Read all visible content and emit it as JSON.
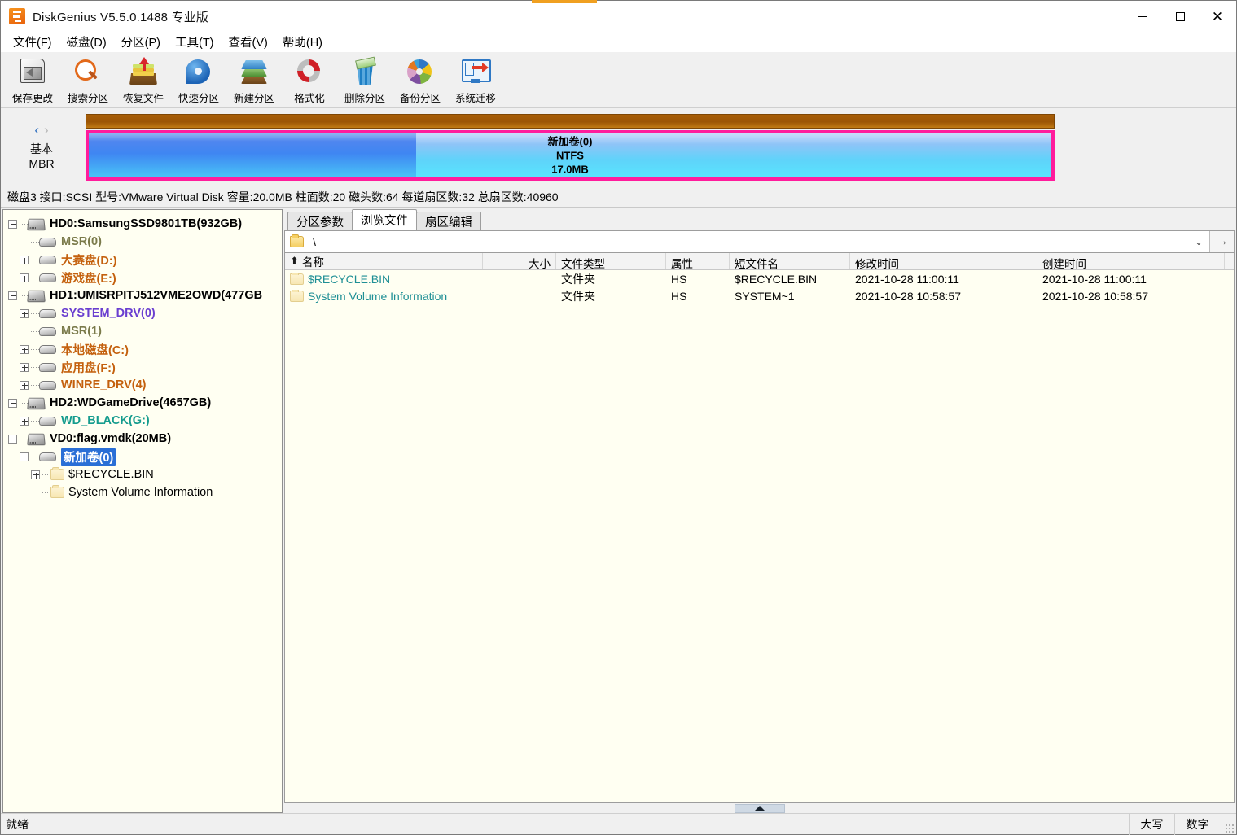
{
  "window": {
    "title": "DiskGenius V5.5.0.1488 专业版",
    "logo_icon": "diskgenius-logo-icon",
    "minimize_label": "—",
    "maximize_label": "",
    "close_label": "✕"
  },
  "menubar": {
    "items": [
      {
        "label": "文件(F)",
        "name": "menu-file"
      },
      {
        "label": "磁盘(D)",
        "name": "menu-disk"
      },
      {
        "label": "分区(P)",
        "name": "menu-partition"
      },
      {
        "label": "工具(T)",
        "name": "menu-tools"
      },
      {
        "label": "查看(V)",
        "name": "menu-view"
      },
      {
        "label": "帮助(H)",
        "name": "menu-help"
      }
    ]
  },
  "toolbar": {
    "buttons": [
      {
        "label": "保存更改",
        "icon": "save-changes-icon"
      },
      {
        "label": "搜索分区",
        "icon": "search-partition-icon"
      },
      {
        "label": "恢复文件",
        "icon": "recover-files-icon"
      },
      {
        "label": "快速分区",
        "icon": "quick-partition-icon"
      },
      {
        "label": "新建分区",
        "icon": "new-partition-icon"
      },
      {
        "label": "格式化",
        "icon": "format-icon"
      },
      {
        "label": "删除分区",
        "icon": "delete-partition-icon"
      },
      {
        "label": "备份分区",
        "icon": "backup-partition-icon"
      },
      {
        "label": "系统迁移",
        "icon": "system-migration-icon"
      }
    ]
  },
  "diskmap": {
    "prev_arrow": "‹",
    "next_arrow": "›",
    "disk_style_line1": "基本",
    "disk_style_line2": "MBR",
    "partition": {
      "name": "新加卷(0)",
      "filesystem": "NTFS",
      "size": "17.0MB",
      "used_percent": 34,
      "border_color": "#ff1c9c"
    }
  },
  "diskinfo": {
    "text": "磁盘3 接口:SCSI  型号:VMware Virtual Disk  容量:20.0MB  柱面数:20  磁头数:64  每道扇区数:32  总扇区数:40960"
  },
  "tree": {
    "nodes": [
      {
        "label": "HD0:SamsungSSD9801TB(932GB)",
        "icon": "disk-icon",
        "expander": "minus",
        "indent": 0,
        "color": "#000000",
        "bold": true
      },
      {
        "label": "MSR(0)",
        "icon": "partition-icon",
        "expander": "none",
        "indent": 1,
        "color": "#7a7a4a",
        "bold": true
      },
      {
        "label": "大赛盘(D:)",
        "icon": "partition-icon",
        "expander": "plus",
        "indent": 1,
        "color": "#c4600d",
        "bold": true
      },
      {
        "label": "游戏盘(E:)",
        "icon": "partition-icon",
        "expander": "plus",
        "indent": 1,
        "color": "#c4600d",
        "bold": true
      },
      {
        "label": "HD1:UMISRPITJ512VME2OWD(477GB",
        "icon": "disk-icon",
        "expander": "minus",
        "indent": 0,
        "color": "#000000",
        "bold": true
      },
      {
        "label": "SYSTEM_DRV(0)",
        "icon": "partition-icon",
        "expander": "plus",
        "indent": 1,
        "color": "#6a3fd0",
        "bold": true
      },
      {
        "label": "MSR(1)",
        "icon": "partition-icon",
        "expander": "none",
        "indent": 1,
        "color": "#7a7a4a",
        "bold": true
      },
      {
        "label": "本地磁盘(C:)",
        "icon": "partition-icon",
        "expander": "plus",
        "indent": 1,
        "color": "#c4600d",
        "bold": true
      },
      {
        "label": "应用盘(F:)",
        "icon": "partition-icon",
        "expander": "plus",
        "indent": 1,
        "color": "#c4600d",
        "bold": true
      },
      {
        "label": "WINRE_DRV(4)",
        "icon": "partition-icon",
        "expander": "plus",
        "indent": 1,
        "color": "#c4600d",
        "bold": true
      },
      {
        "label": "HD2:WDGameDrive(4657GB)",
        "icon": "disk-icon",
        "expander": "minus",
        "indent": 0,
        "color": "#000000",
        "bold": true
      },
      {
        "label": "WD_BLACK(G:)",
        "icon": "partition-icon",
        "expander": "plus",
        "indent": 1,
        "color": "#159c8e",
        "bold": true
      },
      {
        "label": "VD0:flag.vmdk(20MB)",
        "icon": "disk-icon",
        "expander": "minus",
        "indent": 0,
        "color": "#000000",
        "bold": true
      },
      {
        "label": "新加卷(0)",
        "icon": "partition-icon",
        "expander": "minus",
        "indent": 1,
        "color": "#ffffff",
        "bold": true,
        "selected": true
      },
      {
        "label": "$RECYCLE.BIN",
        "icon": "folder-icon",
        "expander": "plus",
        "indent": 2,
        "color": "#000000",
        "bold": false
      },
      {
        "label": "System Volume Information",
        "icon": "folder-icon",
        "expander": "none",
        "indent": 2,
        "color": "#000000",
        "bold": false
      }
    ]
  },
  "tabs": [
    {
      "label": "分区参数",
      "name": "tab-partition-params",
      "active": false
    },
    {
      "label": "浏览文件",
      "name": "tab-browse-files",
      "active": true
    },
    {
      "label": "扇区编辑",
      "name": "tab-sector-edit",
      "active": false
    }
  ],
  "address": {
    "folder_icon": "folder-icon",
    "path": "\\",
    "chevron": "⌄",
    "go": "→"
  },
  "filelist": {
    "sort_indicator": "⬆",
    "columns": [
      {
        "label": "名称",
        "key": "name"
      },
      {
        "label": "大小",
        "key": "size"
      },
      {
        "label": "文件类型",
        "key": "type"
      },
      {
        "label": "属性",
        "key": "attr"
      },
      {
        "label": "短文件名",
        "key": "short"
      },
      {
        "label": "修改时间",
        "key": "mtime"
      },
      {
        "label": "创建时间",
        "key": "ctime"
      }
    ],
    "rows": [
      {
        "name": "$RECYCLE.BIN",
        "size": "",
        "type": "文件夹",
        "attr": "HS",
        "short": "$RECYCLE.BIN",
        "mtime": "2021-10-28 11:00:11",
        "ctime": "2021-10-28 11:00:11",
        "icon": "folder-icon"
      },
      {
        "name": "System Volume Information",
        "size": "",
        "type": "文件夹",
        "attr": "HS",
        "short": "SYSTEM~1",
        "mtime": "2021-10-28 10:58:57",
        "ctime": "2021-10-28 10:58:57",
        "icon": "folder-icon"
      }
    ]
  },
  "statusbar": {
    "message": "就绪",
    "caps": "大写",
    "num": "数字"
  }
}
